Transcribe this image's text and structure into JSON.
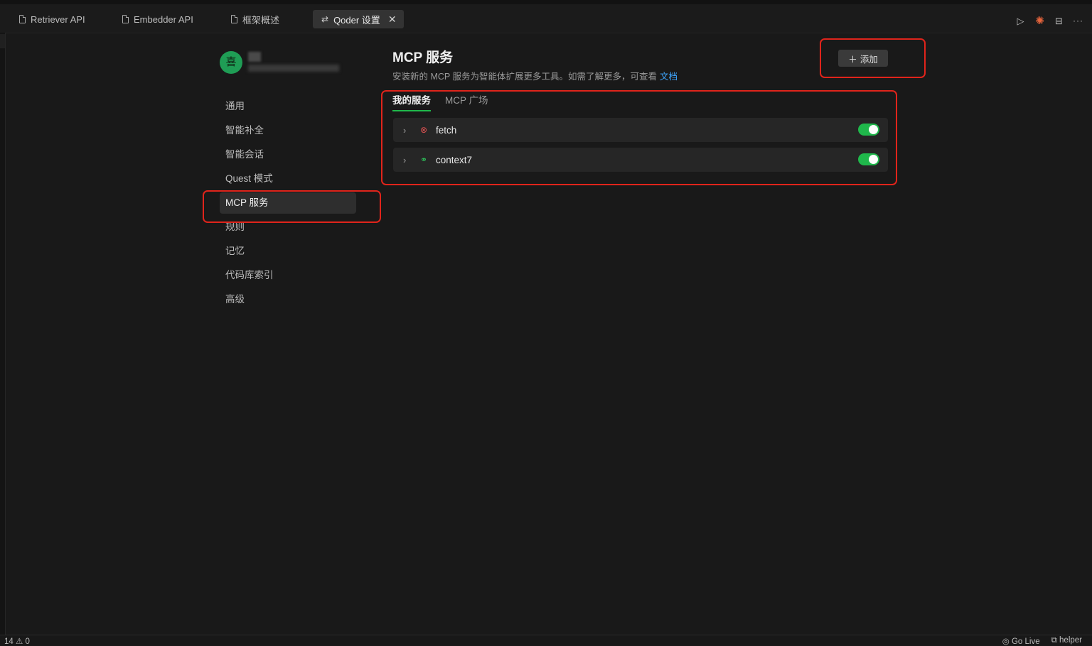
{
  "tabs": [
    {
      "label": "Retriever API",
      "icon": "file-icon"
    },
    {
      "label": "Embedder API",
      "icon": "file-icon"
    },
    {
      "label": "框架概述",
      "icon": "file-icon"
    },
    {
      "label": "Qoder 设置",
      "icon": "settings-icon",
      "active": true
    }
  ],
  "tab_close_glyph": "✕",
  "toolbar_actions": [
    "run-icon",
    "spark-icon",
    "split-editor-icon",
    "more-icon"
  ],
  "user": {
    "avatar_char": "喜"
  },
  "sidebar": {
    "items": [
      {
        "label": "通用"
      },
      {
        "label": "智能补全"
      },
      {
        "label": "智能会话"
      },
      {
        "label": "Quest 模式"
      },
      {
        "label": "MCP 服务",
        "active": true
      },
      {
        "label": "规则"
      },
      {
        "label": "记忆"
      },
      {
        "label": "代码库索引"
      },
      {
        "label": "高级"
      }
    ]
  },
  "main": {
    "title": "MCP 服务",
    "subtitle": "安装新的 MCP 服务为智能体扩展更多工具。如需了解更多，可查看",
    "doc_link": "文档",
    "add_button": "添加",
    "tabs": [
      {
        "label": "我的服务",
        "active": true
      },
      {
        "label": "MCP 广场"
      }
    ],
    "servers": [
      {
        "name": "fetch",
        "status": "error",
        "enabled": true
      },
      {
        "name": "context7",
        "status": "connected",
        "enabled": true
      }
    ]
  },
  "statusbar": {
    "left": "14 ⚠ 0",
    "go_live": "Go Live",
    "helper": "helper"
  },
  "colors": {
    "accent_green": "#1fb84b",
    "highlight_red": "#e0241b",
    "link_blue": "#3ea6ff"
  }
}
